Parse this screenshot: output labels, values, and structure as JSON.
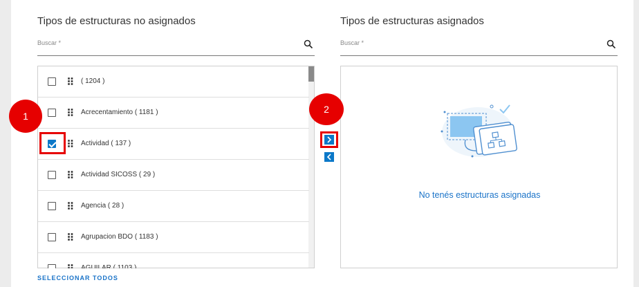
{
  "left_panel": {
    "title": "Tipos de estructuras no asignados",
    "search_label": "Buscar *",
    "items": [
      {
        "label": "( 1204 )",
        "checked": false
      },
      {
        "label": "Acrecentamiento ( 1181 )",
        "checked": false
      },
      {
        "label": "Actividad ( 137 )",
        "checked": true
      },
      {
        "label": "Actividad SICOSS ( 29 )",
        "checked": false
      },
      {
        "label": "Agencia ( 28 )",
        "checked": false
      },
      {
        "label": "Agrupacion BDO ( 1183 )",
        "checked": false
      },
      {
        "label": "AGUILAR ( 1103 )",
        "checked": false
      }
    ],
    "select_all": "SELECCIONAR TODOS"
  },
  "right_panel": {
    "title": "Tipos de estructuras asignados",
    "search_label": "Buscar *",
    "empty_message": "No tenés estructuras asignadas"
  },
  "annotations": {
    "step1": "1",
    "step2": "2",
    "badge_color": "#e60000"
  },
  "transfer_buttons": {
    "move_right_icon": "chevron-right-icon",
    "move_left_icon": "chevron-left-icon"
  },
  "colors": {
    "accent": "#0b78c8",
    "link": "#1a73c8"
  }
}
